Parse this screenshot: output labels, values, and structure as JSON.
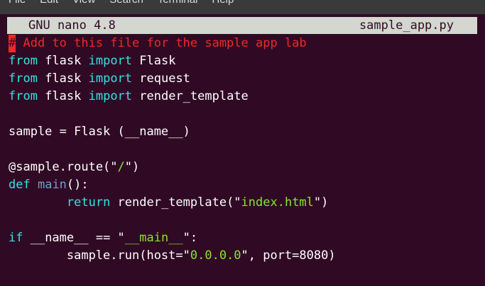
{
  "menubar": {
    "items": [
      "File",
      "Edit",
      "View",
      "Search",
      "Terminal",
      "Help"
    ]
  },
  "nano": {
    "version_label": "GNU nano 4.8",
    "filename": "sample_app.py"
  },
  "editor": {
    "lines": [
      [
        {
          "t": "#",
          "c": "cursor"
        },
        {
          "t": " Add to this file for the sample app lab",
          "c": "comment"
        }
      ],
      [
        {
          "t": "from",
          "c": "kw"
        },
        {
          "t": " flask ",
          "c": ""
        },
        {
          "t": "import",
          "c": "kw"
        },
        {
          "t": " Flask",
          "c": ""
        }
      ],
      [
        {
          "t": "from",
          "c": "kw"
        },
        {
          "t": " flask ",
          "c": ""
        },
        {
          "t": "import",
          "c": "kw"
        },
        {
          "t": " request",
          "c": ""
        }
      ],
      [
        {
          "t": "from",
          "c": "kw"
        },
        {
          "t": " flask ",
          "c": ""
        },
        {
          "t": "import",
          "c": "kw"
        },
        {
          "t": " render_template",
          "c": ""
        }
      ],
      [],
      [
        {
          "t": "sample = Flask (__name__)",
          "c": ""
        }
      ],
      [],
      [
        {
          "t": "@sample.route(\"",
          "c": ""
        },
        {
          "t": "/",
          "c": "str"
        },
        {
          "t": "\")",
          "c": ""
        }
      ],
      [
        {
          "t": "def",
          "c": "kw"
        },
        {
          "t": " ",
          "c": ""
        },
        {
          "t": "main",
          "c": "fn"
        },
        {
          "t": "():",
          "c": ""
        }
      ],
      [
        {
          "t": "        ",
          "c": ""
        },
        {
          "t": "return",
          "c": "kw"
        },
        {
          "t": " render_template(\"",
          "c": ""
        },
        {
          "t": "index.html",
          "c": "str"
        },
        {
          "t": "\")",
          "c": ""
        }
      ],
      [],
      [
        {
          "t": "if",
          "c": "kw"
        },
        {
          "t": " __name__ == \"",
          "c": ""
        },
        {
          "t": "__main__",
          "c": "str"
        },
        {
          "t": "\":",
          "c": ""
        }
      ],
      [
        {
          "t": "        sample.run(host=\"",
          "c": ""
        },
        {
          "t": "0.0.0.0",
          "c": "str"
        },
        {
          "t": "\", port=8080)",
          "c": ""
        }
      ]
    ]
  },
  "colors": {
    "terminal_background": "#300a24",
    "title_bar_background": "#d3d7cf",
    "keyword": "#34e2e2",
    "comment": "#ef2929",
    "string": "#8ae234",
    "function_name": "#729fcf",
    "text": "#ffffff"
  }
}
